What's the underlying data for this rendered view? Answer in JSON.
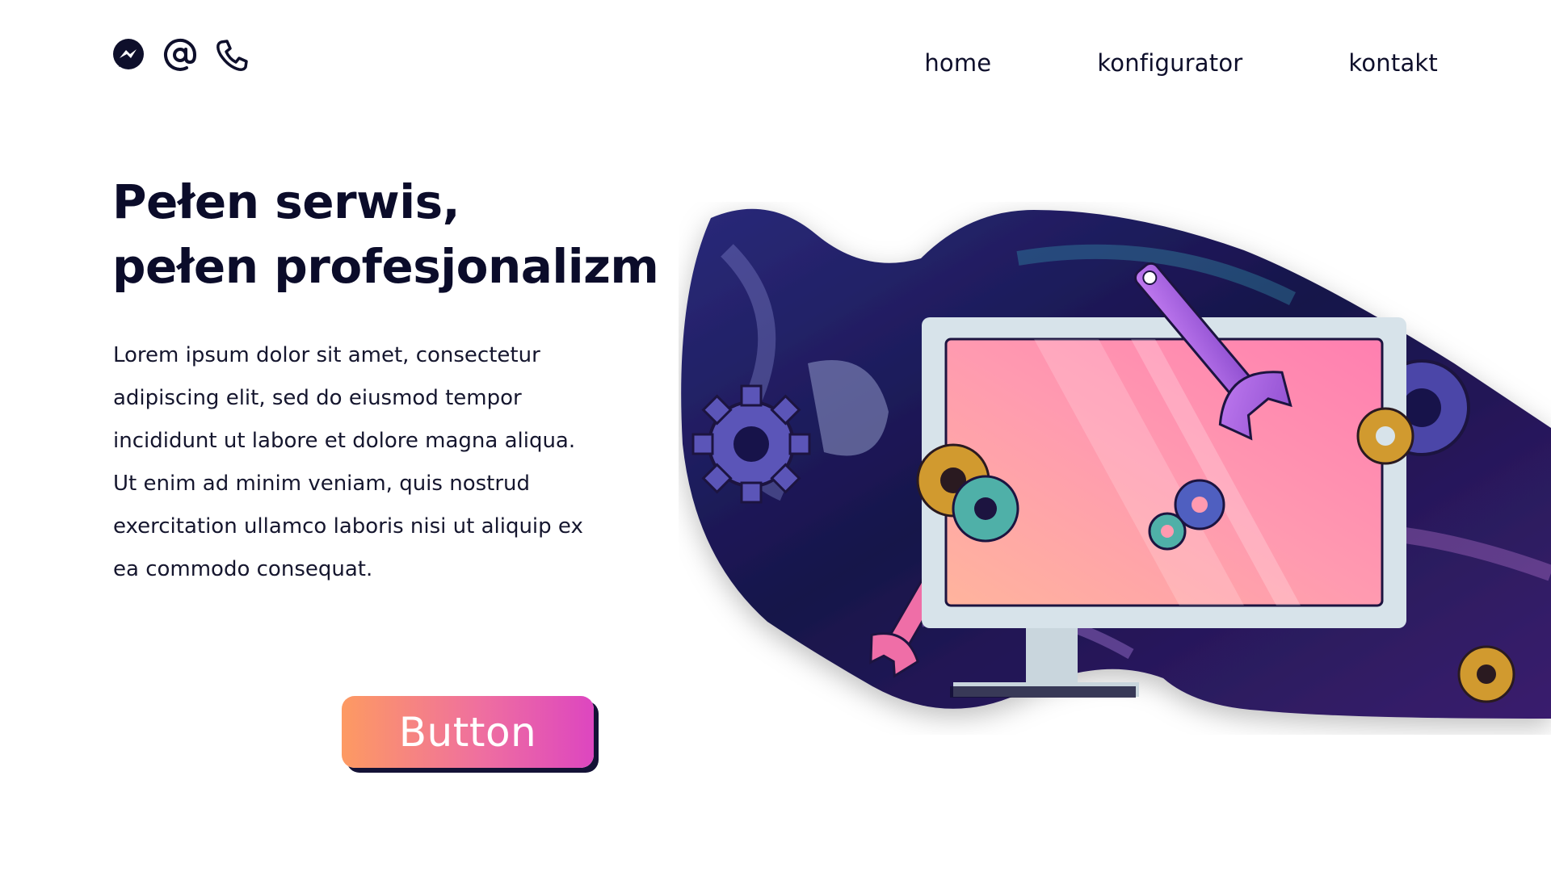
{
  "header": {
    "contact_icons": [
      {
        "name": "messenger-icon",
        "color": "#0e0f2b"
      },
      {
        "name": "at-sign-icon",
        "color": "#0e0f2b"
      },
      {
        "name": "phone-icon",
        "color": "#0e0f2b"
      }
    ],
    "nav": [
      {
        "label": "home"
      },
      {
        "label": "konfigurator"
      },
      {
        "label": "kontakt"
      }
    ]
  },
  "hero": {
    "title_line1": "Pełen serwis,",
    "title_line2": "pełen profesjonalizm",
    "description": "Lorem ipsum dolor sit amet, consectetur adipiscing elit, sed do eiusmod tempor incididunt ut labore et dolore magna aliqua. Ut enim ad minim veniam, quis nostrud exercitation ullamco laboris nisi ut aliquip ex ea commodo consequat.",
    "button_label": "Button"
  },
  "colors": {
    "text_dark": "#0e0f2b",
    "button_gradient_start": "#fd9a62",
    "button_gradient_end": "#dd46c0",
    "blob_dark": "#16134a",
    "screen_pink": "#ff8fb0",
    "monitor_frame": "#d5e1e8"
  }
}
